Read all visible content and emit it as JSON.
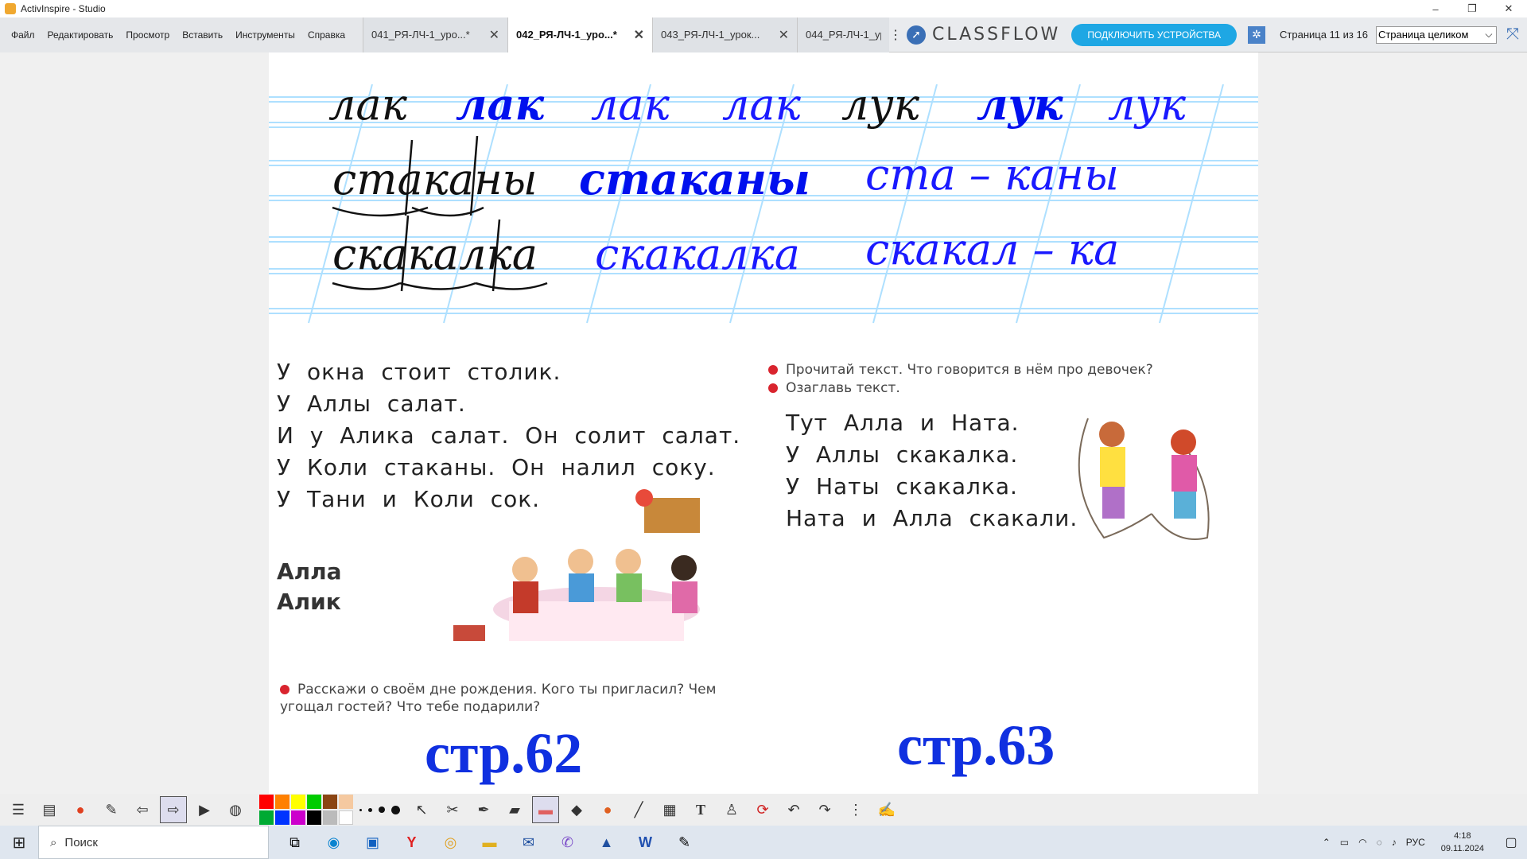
{
  "window": {
    "title": "ActivInspire - Studio",
    "controls": [
      "–",
      "❐",
      "✕"
    ]
  },
  "menu": [
    "Файл",
    "Редактировать",
    "Просмотр",
    "Вставить",
    "Инструменты",
    "Справка"
  ],
  "tabs": [
    {
      "label": "041_РЯ-ЛЧ-1_уро...*",
      "close": "✕"
    },
    {
      "label": "042_РЯ-ЛЧ-1_уро...*",
      "close": "✕"
    },
    {
      "label": "043_РЯ-ЛЧ-1_урок...",
      "close": "✕"
    },
    {
      "label": "044_РЯ-ЛЧ-1_ур",
      "close": ""
    }
  ],
  "tab_overflow": "⋮",
  "classflow": {
    "logo": "CLASSFLOW",
    "connect_button": "ПОДКЛЮЧИТЬ УСТРОЙСТВА"
  },
  "page_counter": "Страница 11 из 16",
  "zoom": {
    "selected": "Страница целиком"
  },
  "handwriting": {
    "row1": [
      "лак",
      "лак",
      "лак",
      "лак",
      "лук",
      "лук",
      "лук"
    ],
    "row2": [
      "стаканы",
      "стаканы",
      "ста – каны"
    ],
    "row3": [
      "скакалка",
      "скакалка",
      "скакал – ка"
    ]
  },
  "page62": {
    "lines": [
      "У окна стоит столик.",
      "У Аллы салат.",
      "И у Алика салат. Он солит салат.",
      "У Коли стаканы. Он налил соку.",
      "У Тани и Коли сок."
    ],
    "names": [
      "Алла",
      "Алик"
    ],
    "task": "Расскажи о своём дне рождения. Кого ты пригласил? Чем угощал гостей? Что тебе подарили?",
    "ref": "стр.62"
  },
  "page63": {
    "tasks": [
      "Прочитай текст. Что говорится в нём про девочек?",
      "Озаглавь текст."
    ],
    "lines": [
      "Тут Алла и Ната.",
      "У Аллы скакалка.",
      "У Наты скакалка.",
      "Ната и Алла скакали."
    ],
    "ref": "стр.63"
  },
  "colors": {
    "ink_black": "#111111",
    "ink_blue": "#1a1aff",
    "accent_blue": "#1ea7e4",
    "bullet_red": "#d9242e",
    "palette": [
      "#ff0000",
      "#ff8000",
      "#ffff00",
      "#00cc00",
      "#8b4513",
      "#f5c9a0",
      "#cc3300",
      "#00aa33",
      "#0033ff",
      "#cc00cc",
      "#000000",
      "#bbbbbb"
    ]
  },
  "taskbar": {
    "search_placeholder": "Поиск",
    "lang": "РУС",
    "time": "4:18",
    "date": "09.11.2024"
  }
}
